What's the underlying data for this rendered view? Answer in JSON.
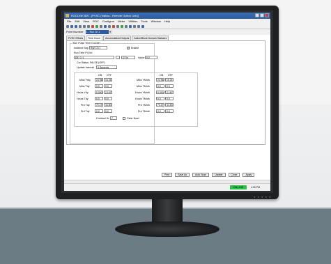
{
  "window": {
    "title": "ROCLINK 800 - [PVSC (Valhas - Remote Option Link)]"
  },
  "menu": [
    "File",
    "Edit",
    "View",
    "ROC",
    "Configure",
    "Meter",
    "Utilities",
    "Tools",
    "Window",
    "Help"
  ],
  "point_bar": {
    "label": "Point Number:",
    "selected": "1 - Run Ch 1"
  },
  "tabs": [
    "PVSC Effects",
    "Time Count",
    "Accumulation/Outputs",
    "Action/Block Domain Statuses"
  ],
  "form": {
    "group_title": "True Pulse Time Counter",
    "instance_tag_label": "Instance Tag:",
    "instance_tag_value": "Run Ch 1",
    "enable_label": "Enable",
    "run_time_label": "Run Time PI Eel:",
    "run_time_value": "DE, 0, 1",
    "run_time_units": "DT In",
    "value_label": "Value:",
    "value_value": "0.0",
    "cur_status": "Cur Status: FALSE (OFF)",
    "update_interval_label": "Update Interval:",
    "update_interval_value": "3 Seconds",
    "col_on": "ON",
    "col_off": "OFF",
    "rows_left": [
      {
        "label": "Mins Yrdy",
        "on": "24.9888",
        "off": "15.25"
      },
      {
        "label": "Mins Tdy",
        "on": "0.0",
        "off": "0.0"
      },
      {
        "label": "Hours Ydy",
        "on": "0.00049",
        "off": "2.1679"
      },
      {
        "label": "Hours Tdy",
        "on": "0.0",
        "off": "0.0"
      },
      {
        "label": "Prd Ydy",
        "on": "70.1979",
        "off": "44.8024"
      },
      {
        "label": "Prd Tdy",
        "on": "0.0",
        "off": "0.0"
      }
    ],
    "rows_right": [
      {
        "label": "Mins YMnth",
        "on": "24.9888",
        "off": "15.25"
      },
      {
        "label": "Mins TMnth",
        "on": "0.0",
        "off": "0.0"
      },
      {
        "label": "Hours YMnth",
        "on": "0.00049",
        "off": "2.1679"
      },
      {
        "label": "Hours TMnth",
        "on": "0.0",
        "off": "0.0"
      },
      {
        "label": "Prd YMnth",
        "on": "70.1979",
        "off": "44.8024"
      },
      {
        "label": "Prd TMnth",
        "on": "0.0",
        "off": "0.0"
      }
    ],
    "contract_hr_label": "Contract Hr:",
    "contract_hr_value": "7",
    "clear_now_label": "Clear Now!"
  },
  "buttons": [
    "Print",
    "Save As",
    "Auto Scan",
    "Update",
    "Close",
    "Apply"
  ],
  "status": {
    "online": "ON-LINE",
    "time": "4:30 PM"
  }
}
